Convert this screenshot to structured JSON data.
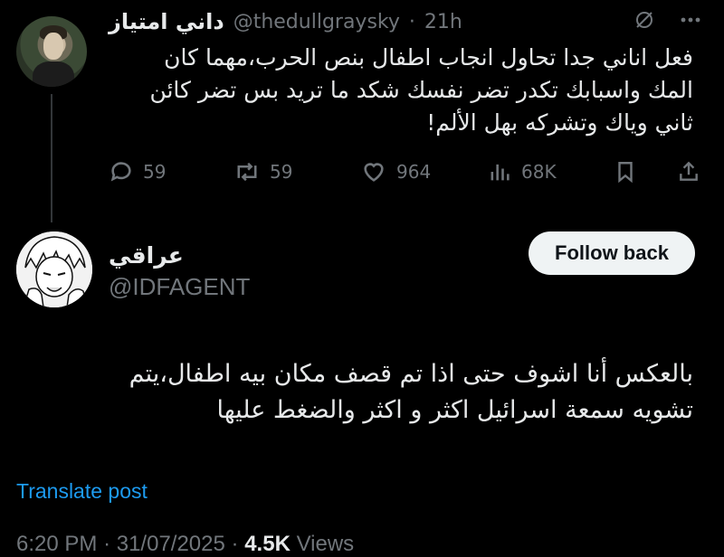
{
  "parent_tweet": {
    "author_name": "داني امتياز",
    "handle": "@thedullgraysky",
    "separator": "·",
    "time": "21h",
    "text_lines": [
      "فعل اناني جدا تحاول انجاب اطفال بنص الحرب،مهما كان",
      "المك واسبابك تكدر تضر نفسك شكد ما تريد بس تضر كائن",
      "ثاني وياك وتشركه بهل الألم!"
    ],
    "icons": [
      "grok-icon",
      "more-icon"
    ],
    "actions": {
      "replies": "59",
      "retweets": "59",
      "likes": "964",
      "views": "68K"
    }
  },
  "reply_tweet": {
    "author_name": "عراقي",
    "handle": "@IDFAGENT",
    "follow_label": "Follow back",
    "text_lines": [
      "بالعكس أنا اشوف حتى اذا تم قصف مكان بيه اطفال،يتم",
      "تشويه سمعة اسرائيل اكثر و اكثر والضغط عليها"
    ],
    "translate_label": "Translate post",
    "time": "6:20 PM",
    "date": "31/07/2025",
    "separator": "·",
    "views_count": "4.5K",
    "views_label": "Views"
  },
  "colors": {
    "background": "#000000",
    "text": "#e7e9ea",
    "muted": "#71767b",
    "link": "#1d9bf0",
    "button_bg": "#eff3f4"
  }
}
